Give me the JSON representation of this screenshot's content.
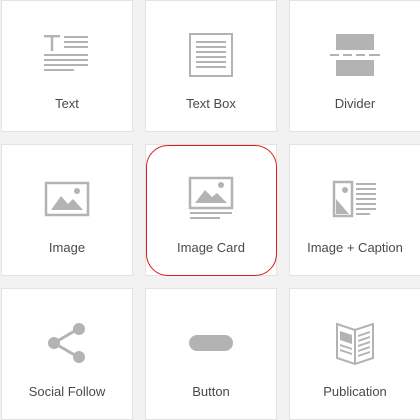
{
  "blocks": [
    {
      "label": "Text",
      "icon": "text-icon"
    },
    {
      "label": "Text Box",
      "icon": "text-box-icon"
    },
    {
      "label": "Divider",
      "icon": "divider-icon"
    },
    {
      "label": "Image",
      "icon": "image-icon"
    },
    {
      "label": "Image Card",
      "icon": "image-card-icon"
    },
    {
      "label": "Image + Caption",
      "icon": "image-caption-icon"
    },
    {
      "label": "Social Follow",
      "icon": "share-icon"
    },
    {
      "label": "Button",
      "icon": "button-icon"
    },
    {
      "label": "Publication",
      "icon": "publication-icon"
    }
  ],
  "highlighted_block": "Image Card",
  "colors": {
    "icon_gray": "#b3b3b3",
    "label_text": "#4a4a4a",
    "highlight_red": "#d91c1c",
    "background": "#f2f2f2"
  }
}
